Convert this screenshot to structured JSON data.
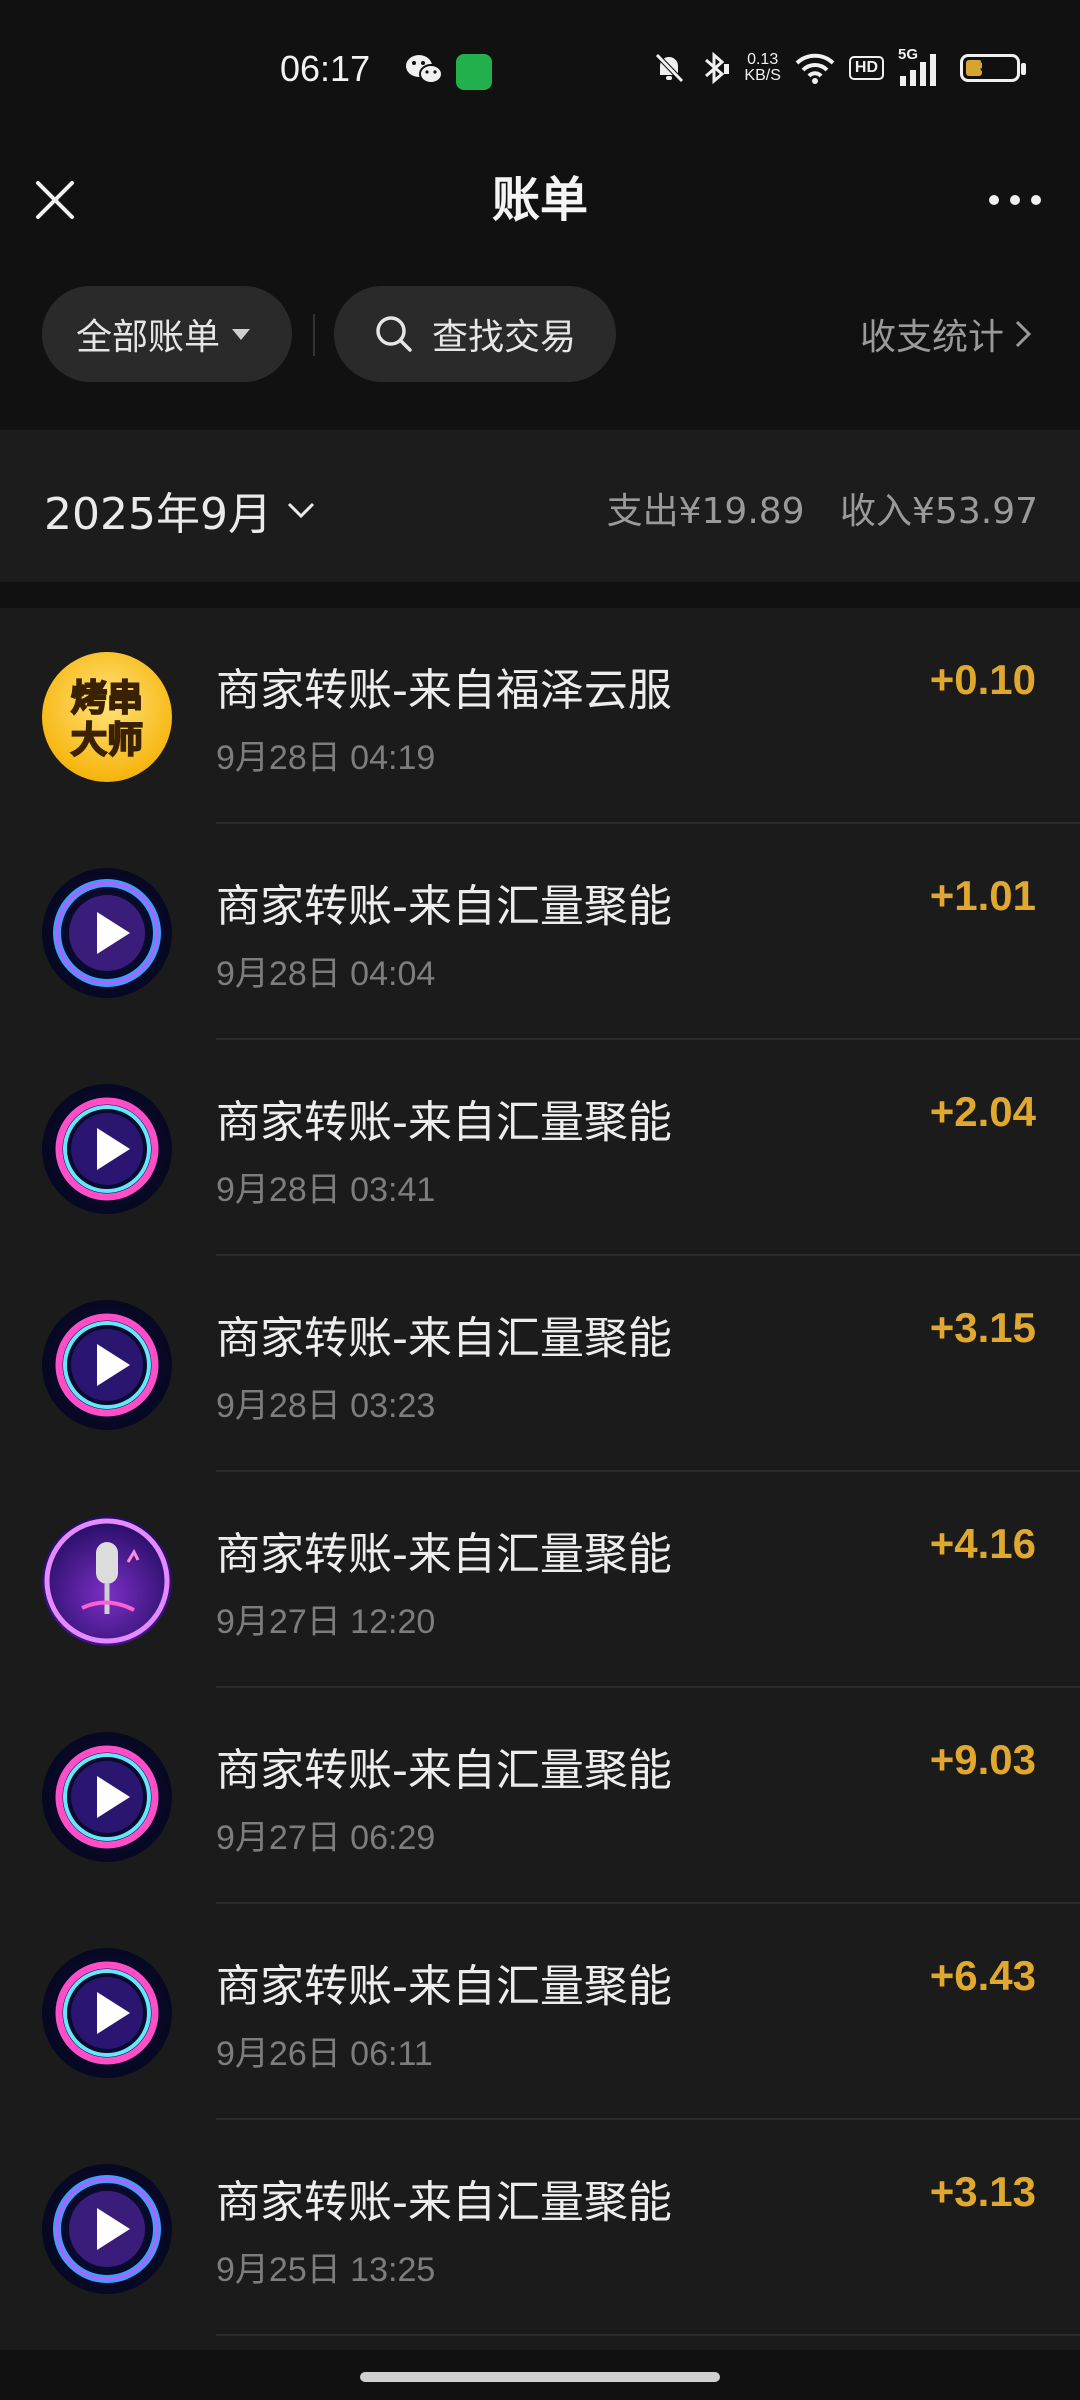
{
  "status_bar": {
    "time": "06:17",
    "net_speed_value": "0.13",
    "net_speed_unit": "KB/S",
    "hd": "HD",
    "signal": "5G",
    "battery": "30"
  },
  "nav": {
    "title": "账单"
  },
  "filters": {
    "all_bills": "全部账单",
    "search": "查找交易",
    "stats": "收支统计"
  },
  "month": {
    "label": "2025年9月",
    "expense": "支出¥19.89",
    "income": "收入¥53.97"
  },
  "transactions": [
    {
      "title": "商家转账-来自福泽云服",
      "time": "9月28日 04:19",
      "amount": "+0.10",
      "avatar_text": [
        "烤串",
        "大师"
      ]
    },
    {
      "title": "商家转账-来自汇量聚能",
      "time": "9月28日 04:04",
      "amount": "+1.01"
    },
    {
      "title": "商家转账-来自汇量聚能",
      "time": "9月28日 03:41",
      "amount": "+2.04"
    },
    {
      "title": "商家转账-来自汇量聚能",
      "time": "9月28日 03:23",
      "amount": "+3.15"
    },
    {
      "title": "商家转账-来自汇量聚能",
      "time": "9月27日 12:20",
      "amount": "+4.16"
    },
    {
      "title": "商家转账-来自汇量聚能",
      "time": "9月27日 06:29",
      "amount": "+9.03"
    },
    {
      "title": "商家转账-来自汇量聚能",
      "time": "9月26日 06:11",
      "amount": "+6.43"
    },
    {
      "title": "商家转账-来自汇量聚能",
      "time": "9月25日 13:25",
      "amount": "+3.13"
    }
  ],
  "colors": {
    "amount": "#e0a82e",
    "background": "#111111",
    "list_bg": "#1b1b1b"
  },
  "icons": [
    "close-icon",
    "more-icon",
    "search-icon",
    "chevron-right-icon",
    "chevron-down-icon",
    "play-icon",
    "microphone-icon"
  ]
}
